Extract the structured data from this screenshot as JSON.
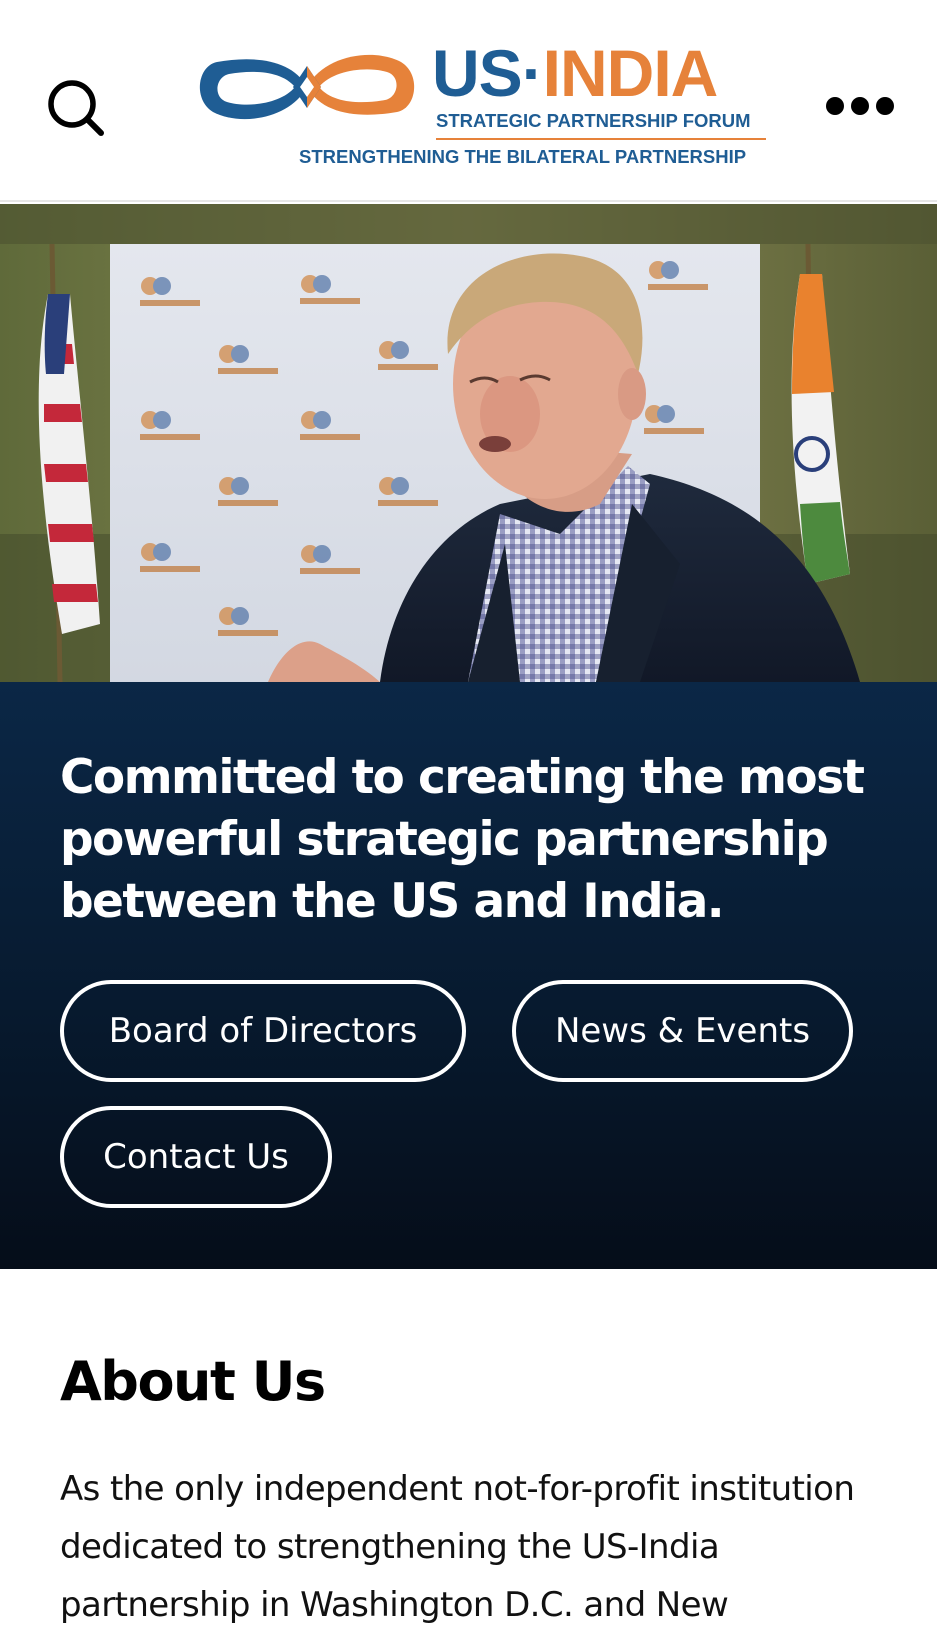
{
  "header": {
    "logo": {
      "title_us": "US",
      "title_dot": "·",
      "title_india": "INDIA",
      "subtitle": "STRATEGIC PARTNERSHIP FORUM",
      "tagline": "STRENGTHENING THE BILATERAL PARTNERSHIP"
    },
    "icons": {
      "search": "search-icon",
      "more": "more-horizontal-icon"
    }
  },
  "hero": {
    "headline": "Committed to creating the most powerful strategic partnership between the US and India.",
    "buttons": [
      {
        "label": "Board of Directors"
      },
      {
        "label": "News & Events"
      },
      {
        "label": "Contact Us"
      }
    ]
  },
  "about": {
    "title": "About Us",
    "body": "As the only independent not-for-profit institution dedicated to strengthening the US-India partnership in Washington D.C. and New"
  },
  "colors": {
    "brand_blue": "#1f5d94",
    "brand_orange": "#e6823a",
    "hero_panel": "#0b2746"
  }
}
